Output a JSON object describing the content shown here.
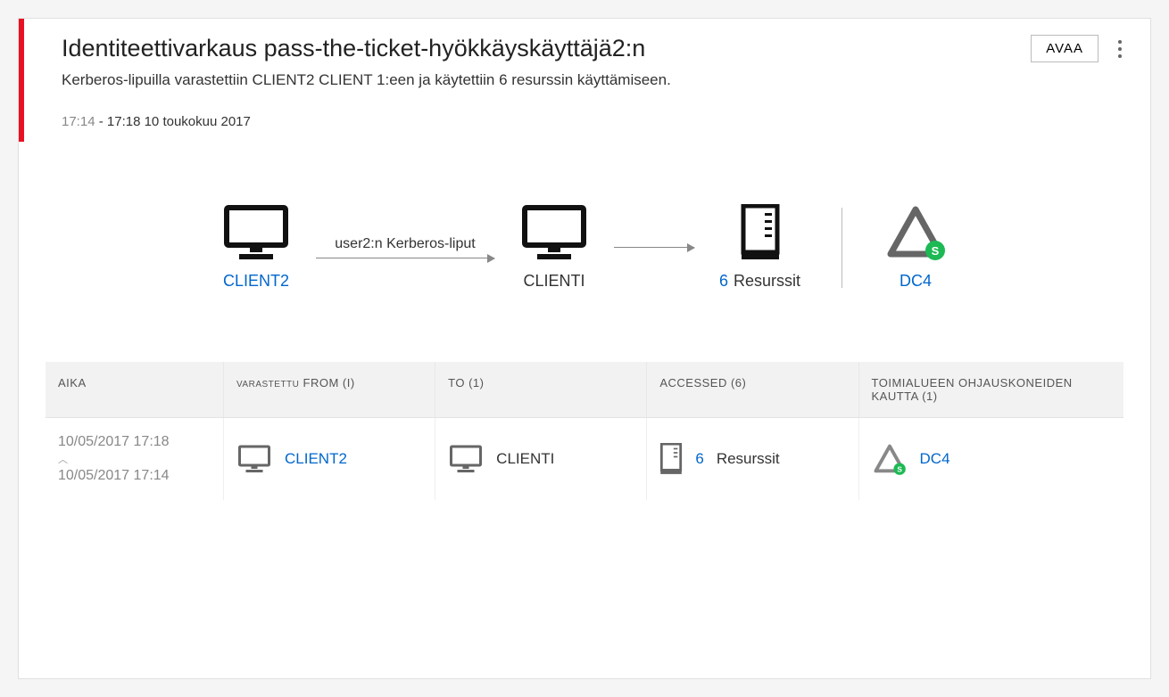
{
  "header": {
    "title": "Identiteettivarkaus pass-the-ticket-hyökkäyskäyttäjä2:n",
    "subtitle": "Kerberos-lipuilla varastettiin CLIENT2 CLIENT 1:een ja käytettiin 6 resurssin käyttämiseen.",
    "time_start": "17:14",
    "time_sep": " - ",
    "time_end": "17:18 10 toukokuu 2017",
    "open_label": "AVAA"
  },
  "diagram": {
    "from_label": "CLIENT2",
    "arrow1_label": "user2:n Kerberos-liput",
    "to_label": "CLIENTI",
    "resource_count": "6",
    "resource_label": "Resurssit",
    "dc_label": "DC4"
  },
  "table": {
    "columns": {
      "col1": "AIKA",
      "col2_prefix": "VARASTETTU",
      "col2": "FROM (I)",
      "col3": "TO (1)",
      "col4": "ACCESSED (6)",
      "col5": "TOIMIALUEEN OHJAUSKONEIDEN KAUTTA (1)"
    },
    "row1": {
      "time_from": "10/05/2017 17:18",
      "time_to": "10/05/2017 17:14",
      "from_val": "CLIENT2",
      "to_val": "CLIENTI",
      "accessed_count": "6",
      "accessed_label": "Resurssit",
      "dc_val": "DC4"
    }
  }
}
